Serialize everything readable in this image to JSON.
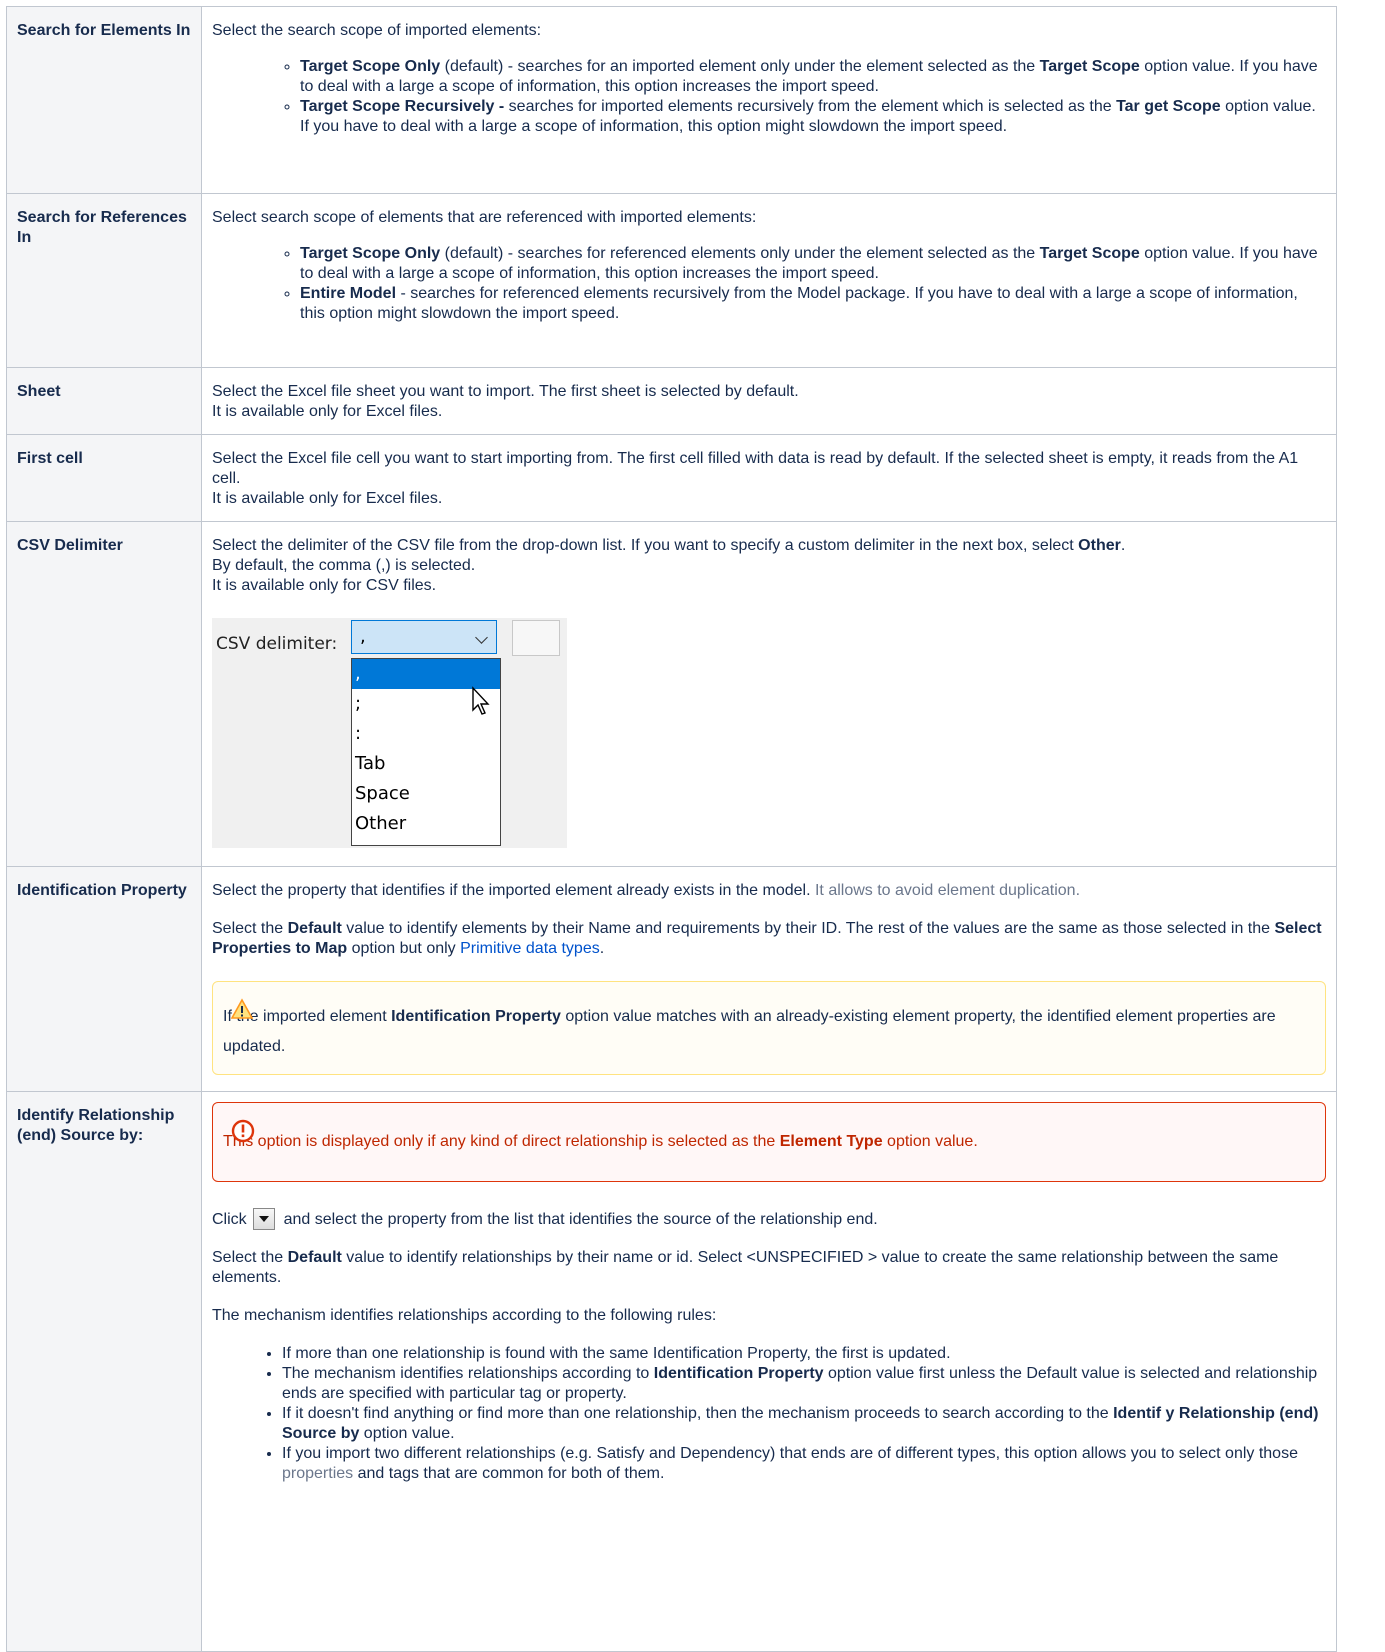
{
  "rows": {
    "search_elements": {
      "key": "Search for Elements In",
      "intro": "Select the search scope of imported elements:",
      "items": [
        {
          "b1": "Target Scope Only",
          "t1": " (default) - searches for an imported element only under the element selected as the ",
          "b2": "Target Scope",
          "t2": " option value. If you have to deal with a large a scope of information, this option increases the import speed."
        },
        {
          "b1": "Target Scope Recursively -",
          "t1": " searches for imported elements recursively from the element which is selected as the ",
          "b2": "Tar get Scope",
          "t2": " option value. If you have to deal with a large a scope of information, this option might slowdown the import speed."
        }
      ]
    },
    "search_references": {
      "key": "Search for References In",
      "intro": "Select search scope of elements that are referenced with imported elements:",
      "items": [
        {
          "b1": "Target Scope Only",
          "t1": " (default) - searches for referenced elements only under the element selected as the ",
          "b2": "Target Scope",
          "t2": " option value. If you have to deal with a large a scope of information, this option increases the import speed."
        },
        {
          "b1": "Entire Model",
          "t1": " - searches for referenced elements recursively from the Model package. If you have to deal with a large a scope of information, this option might slowdown the import speed.",
          "b2": "",
          "t2": ""
        }
      ]
    },
    "sheet": {
      "key": "Sheet",
      "line1": "Select the Excel file sheet you want to import. The first sheet is selected by default.",
      "line2": "It is available only for Excel files."
    },
    "first_cell": {
      "key": "First cell",
      "line1": "Select the Excel file cell you want to start importing from. The first cell filled with data is read by default. If the selected sheet is empty, it reads from the A1 cell.",
      "line2": "It is available only for Excel files."
    },
    "csv": {
      "key": "CSV Delimiter",
      "t1": "Select the delimiter of the CSV file from the drop-down list. If you want to specify a custom delimiter in the next box, select ",
      "b1": "Other",
      "t2": ".",
      "line2": "By default, the comma (,) is selected.",
      "line3": "It is available only for CSV files.",
      "widget": {
        "label": "CSV delimiter:",
        "selected": ",",
        "options": [
          ",",
          ";",
          ":",
          "Tab",
          "Space",
          "Other"
        ]
      }
    },
    "identification": {
      "key": "Identification Property",
      "p1a": "Select the property that identifies if the imported element already exists in the model. ",
      "p1b": "It allows to avoid element duplication.",
      "p2a": "Select the ",
      "p2b": "Default",
      "p2c": " value to identify elements by their Name and requirements by their ID. The rest of the values are the same as those selected in the ",
      "p2d": "Select Properties to Map",
      "p2e": " option but only ",
      "p2link": "Primitive data types",
      "p2f": ".",
      "warn_a": "If the imported element ",
      "warn_b": "Identification Property",
      "warn_c": " option value matches with an already-existing element property, the identified element properties are updated."
    },
    "relationship": {
      "key": "Identify Relationship (end) Source by:",
      "err_a": "This option is displayed only if any kind of direct relationship is selected as the ",
      "err_b": "Element Type",
      "err_c": " option value.",
      "click_a": "Click",
      "click_b": "and select the property from the list that identifies the source of the relationship end.",
      "p2a": "Select the ",
      "p2b": "Default",
      "p2c": " value to identify relationships by their name or id. Select <UNSPECIFIED > value to create the same relationship between the same elements.",
      "p3": "The mechanism identifies relationships according to the following rules:",
      "rule1": "If more than one relationship is found with the same Identification Property, the first is updated.",
      "rule2a": "The mechanism identifies relationships according to ",
      "rule2b": "Identification Property",
      "rule2c": " option value first unless the Default value is selected and relationship ends are specified with particular tag or property.",
      "rule3a": "If it doesn't find anything or find more than one relationship, then the mechanism proceeds to search according to the ",
      "rule3b": "Identif y Relationship (end) Source by",
      "rule3c": " option value.",
      "rule4a": "If you import two different relationships (e.g. Satisfy and Dependency) that ends are of different types, this option allows you to select only those ",
      "rule4b": "properties",
      "rule4c": " and tags that are common for both of them."
    }
  },
  "colors": {
    "link": "#0052cc",
    "warning_border": "#ffe380",
    "error_border": "#de350b",
    "error_text": "#bf2600"
  },
  "icons": {
    "warning": "warning-triangle-icon",
    "error": "error-circle-icon",
    "dropdown": "dropdown-arrow-icon"
  }
}
